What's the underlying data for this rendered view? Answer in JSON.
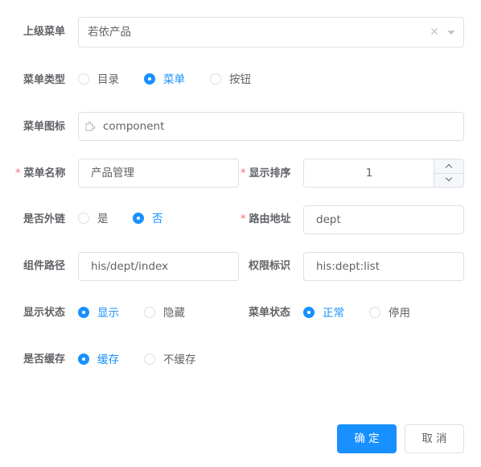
{
  "form": {
    "parent_menu": {
      "label": "上级菜单",
      "value": "若依产品"
    },
    "menu_type": {
      "label": "菜单类型",
      "options": [
        "目录",
        "菜单",
        "按钮"
      ],
      "selected": "菜单"
    },
    "menu_icon": {
      "label": "菜单图标",
      "value": "component"
    },
    "menu_name": {
      "label": "菜单名称",
      "value": "产品管理",
      "required_mark": "*"
    },
    "sort_order": {
      "label": "显示排序",
      "value": "1",
      "required_mark": "*"
    },
    "is_external": {
      "label": "是否外链",
      "options": [
        "是",
        "否"
      ],
      "selected": "否"
    },
    "route_path": {
      "label": "路由地址",
      "value": "dept",
      "required_mark": "*"
    },
    "component_path": {
      "label": "组件路径",
      "value": "his/dept/index"
    },
    "permission": {
      "label": "权限标识",
      "value": "his:dept:list"
    },
    "visible": {
      "label": "显示状态",
      "options": [
        "显示",
        "隐藏"
      ],
      "selected": "显示"
    },
    "status": {
      "label": "菜单状态",
      "options": [
        "正常",
        "停用"
      ],
      "selected": "正常"
    },
    "is_cache": {
      "label": "是否缓存",
      "options": [
        "缓存",
        "不缓存"
      ],
      "selected": "缓存"
    }
  },
  "footer": {
    "confirm_label": "确 定",
    "cancel_label": "取 消"
  },
  "colors": {
    "primary": "#1890ff",
    "required": "#f56c6c",
    "border": "#dcdfe6"
  },
  "icons": {
    "menu_icon_preview": "component-icon",
    "clear": "close-icon",
    "dropdown": "chevron-down-icon"
  }
}
